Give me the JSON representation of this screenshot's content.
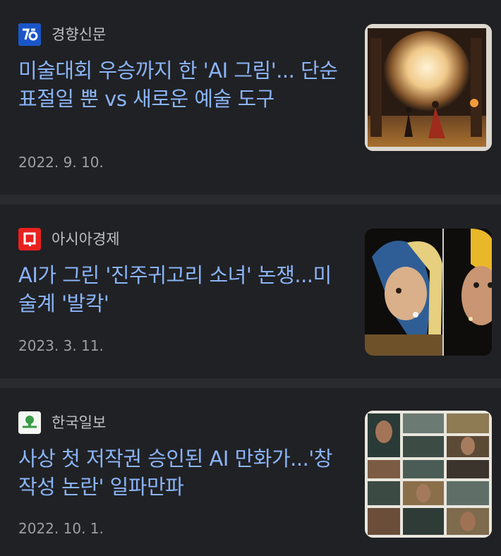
{
  "articles": [
    {
      "source": "경향신문",
      "source_icon": "kyunghyang-logo-icon",
      "source_color": "#1a56c9",
      "headline": "미술대회 우승까지 한 'AI 그림'... 단순 표절일 뿐 vs 새로운 예술 도구",
      "date": "2022. 9. 10.",
      "thumbnail": "ai-painting-thumbnail"
    },
    {
      "source": "아시아경제",
      "source_icon": "asiae-logo-icon",
      "source_color": "#e8211f",
      "headline": "AI가 그린 '진주귀고리 소녀' 논쟁...미술계 '발칵'",
      "date": "2023. 3. 11.",
      "thumbnail": "pearl-earring-thumbnail"
    },
    {
      "source": "한국일보",
      "source_icon": "hankookilbo-logo-icon",
      "source_color": "#3a9b46",
      "headline": "사상 첫 저작권 승인된 AI 만화가...'창작성 논란' 일파만파",
      "date": "2022. 10. 1.",
      "thumbnail": "ai-comic-thumbnail"
    }
  ],
  "colors": {
    "background": "#202124",
    "separator": "#2a2b2e",
    "headline": "#8ab4f8",
    "source": "#bdc1c6",
    "date": "#9aa0a6"
  }
}
